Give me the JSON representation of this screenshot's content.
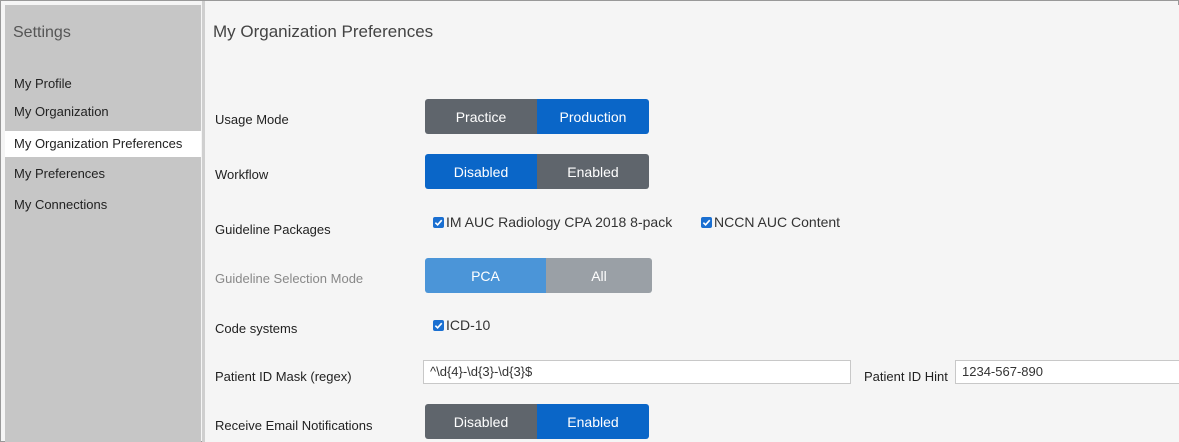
{
  "sidebar": {
    "title": "Settings",
    "items": [
      {
        "label": "My Profile"
      },
      {
        "label": "My Organization"
      },
      {
        "label": "My Organization Preferences"
      },
      {
        "label": "My Preferences"
      },
      {
        "label": "My Connections"
      }
    ],
    "active_index": 2
  },
  "main": {
    "title": "My Organization Preferences",
    "usage_mode": {
      "label": "Usage Mode",
      "options": [
        "Practice",
        "Production"
      ],
      "selected": "Production"
    },
    "workflow": {
      "label": "Workflow",
      "options": [
        "Disabled",
        "Enabled"
      ],
      "selected": "Disabled"
    },
    "guideline_packages": {
      "label": "Guideline Packages",
      "items": [
        {
          "label": "IM AUC Radiology CPA 2018 8-pack",
          "checked": true
        },
        {
          "label": "NCCN AUC Content",
          "checked": true
        }
      ]
    },
    "guideline_selection_mode": {
      "label": "Guideline Selection Mode",
      "options": [
        "PCA",
        "All"
      ],
      "selected": "PCA",
      "disabled": true
    },
    "code_systems": {
      "label": "Code systems",
      "items": [
        {
          "label": "ICD-10",
          "checked": true
        }
      ]
    },
    "patient_id_mask": {
      "label": "Patient ID Mask (regex)",
      "value": "^\\d{4}-\\d{3}-\\d{3}$"
    },
    "patient_id_hint": {
      "label": "Patient ID Hint",
      "value": "1234-567-890"
    },
    "email_notifications": {
      "label": "Receive Email Notifications",
      "options": [
        "Disabled",
        "Enabled"
      ],
      "selected": "Enabled"
    }
  },
  "colors": {
    "selected": "#0a66c8",
    "unselected": "#5f656c",
    "sidebar_bg": "#c6c6c6"
  }
}
